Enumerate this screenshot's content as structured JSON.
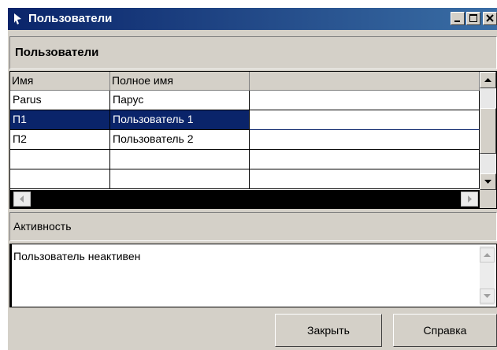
{
  "window": {
    "title": "Пользователи"
  },
  "section": {
    "title": "Пользователи"
  },
  "grid": {
    "columns": [
      "Имя",
      "Полное имя",
      ""
    ],
    "rows": [
      {
        "name": "Parus",
        "full_name": "Парус",
        "selected": false
      },
      {
        "name": "П1",
        "full_name": "Пользователь 1",
        "selected": true
      },
      {
        "name": "П2",
        "full_name": "Пользователь 2",
        "selected": false
      },
      {
        "name": "",
        "full_name": "",
        "selected": false
      },
      {
        "name": "",
        "full_name": "",
        "selected": false
      }
    ]
  },
  "activity": {
    "title": "Активность",
    "text": "Пользователь неактивен"
  },
  "buttons": {
    "close_label": "Закрыть",
    "help_label": "Справка"
  },
  "colors": {
    "title_start": "#0a246a",
    "title_end": "#3a6ea5",
    "selection": "#0a246a",
    "face": "#d4d0c8"
  },
  "icons": {
    "title": "arrow-pointer-icon",
    "minimize": "minimize-icon",
    "maximize": "maximize-icon",
    "close": "close-icon",
    "scroll_up": "arrow-up-icon",
    "scroll_down": "arrow-down-icon",
    "scroll_left": "arrow-left-icon",
    "scroll_right": "arrow-right-icon"
  }
}
